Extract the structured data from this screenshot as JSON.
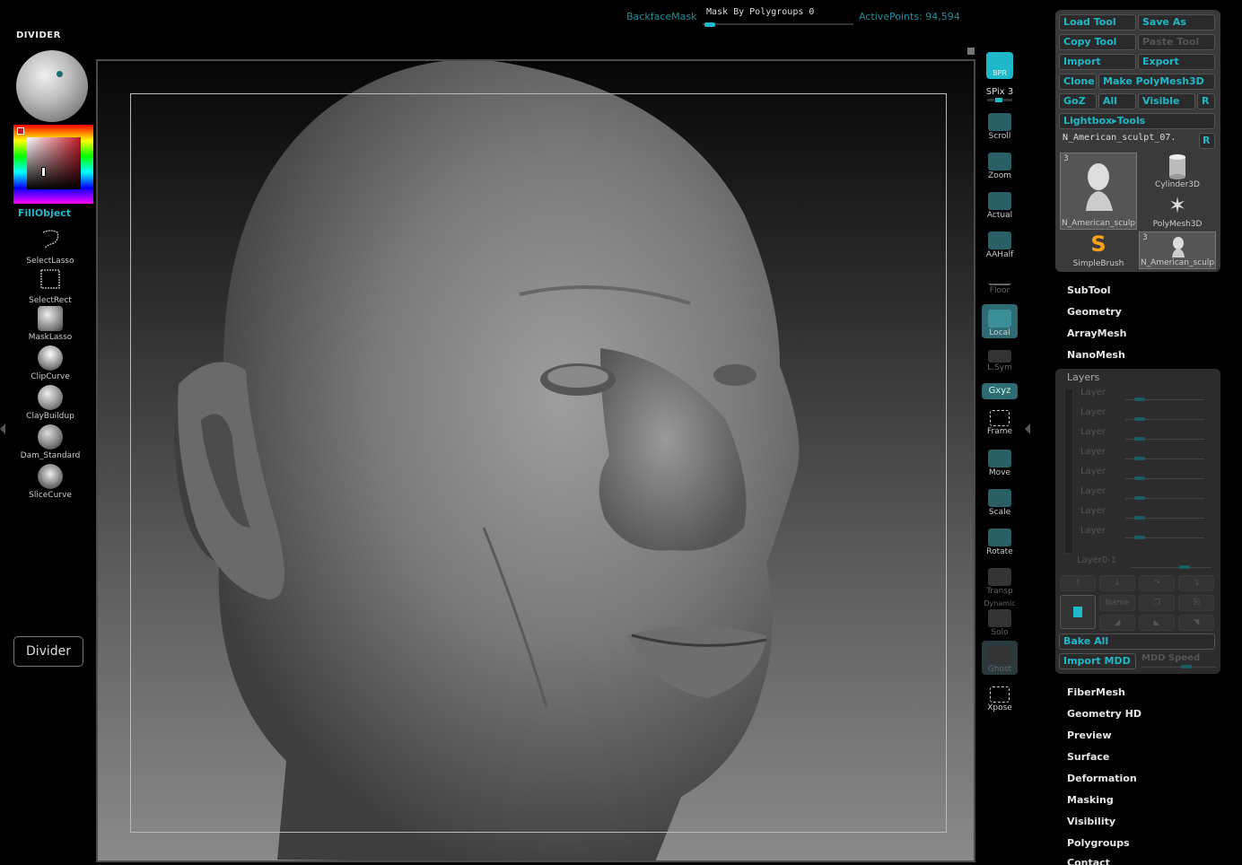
{
  "topbar": {
    "backface_mask": "BackfaceMask",
    "mask_by_polygroups": "Mask By Polygroups 0",
    "mask_by_polygroups_value": 0,
    "active_points": "ActivePoints: 94,594"
  },
  "left": {
    "title": "DIVIDER",
    "fill_label": "FillObject",
    "tools": [
      {
        "label": "SelectLasso",
        "icon": "select-lasso-icon"
      },
      {
        "label": "SelectRect",
        "icon": "select-rect-icon"
      },
      {
        "label": "MaskLasso",
        "icon": "mask-lasso-icon"
      },
      {
        "label": "ClipCurve",
        "icon": "clip-curve-icon"
      },
      {
        "label": "ClayBuildup",
        "icon": "clay-buildup-icon"
      },
      {
        "label": "Dam_Standard",
        "icon": "dam-standard-icon"
      },
      {
        "label": "SliceCurve",
        "icon": "slice-curve-icon"
      }
    ],
    "divider_button": "Divider",
    "colors": {
      "accent": "#1fb8c8",
      "brush_color": "#c51828"
    }
  },
  "rightbar": {
    "bpr": "BPR",
    "spix": "SPix 3",
    "spix_value": 3,
    "tools": [
      "Scroll",
      "Zoom",
      "Actual",
      "AAHalf",
      "Floor",
      "Local",
      "L.Sym",
      "Frame",
      "Move",
      "Scale",
      "Rotate",
      "Transp",
      "Solo",
      "Ghost",
      "Xpose"
    ],
    "xyz": "Gxyz",
    "dynamic": "Dynamic"
  },
  "palette": {
    "load_tool": "Load Tool",
    "save_as": "Save As",
    "copy_tool": "Copy Tool",
    "paste_tool": "Paste Tool",
    "import": "Import",
    "export": "Export",
    "clone": "Clone",
    "make_polymesh": "Make PolyMesh3D",
    "goz": "GoZ",
    "all": "All",
    "visible": "Visible",
    "r": "R",
    "lightbox": "Lightbox▸Tools",
    "current_tool": "N_American_sculpt_07.",
    "thumbs": [
      {
        "label": "N_American_sculp",
        "count": "3"
      },
      {
        "label": "Cylinder3D"
      },
      {
        "label": "PolyMesh3D"
      },
      {
        "label": "SimpleBrush"
      },
      {
        "label": "N_American_sculp",
        "count": "3"
      }
    ]
  },
  "menus_top": [
    "SubTool",
    "Geometry",
    "ArrayMesh",
    "NanoMesh"
  ],
  "layers": {
    "title": "Layers",
    "rows": [
      "Layer",
      "Layer",
      "Layer",
      "Layer",
      "Layer",
      "Layer",
      "Layer",
      "Layer"
    ],
    "layer0": "Layer0-1",
    "name_btn": "Name",
    "bake_all": "Bake All",
    "import_mdd": "Import MDD",
    "mdd_speed": "MDD Speed"
  },
  "menus_bottom": [
    "FiberMesh",
    "Geometry HD",
    "Preview",
    "Surface",
    "Deformation",
    "Masking",
    "Visibility",
    "Polygroups",
    "Contact"
  ]
}
